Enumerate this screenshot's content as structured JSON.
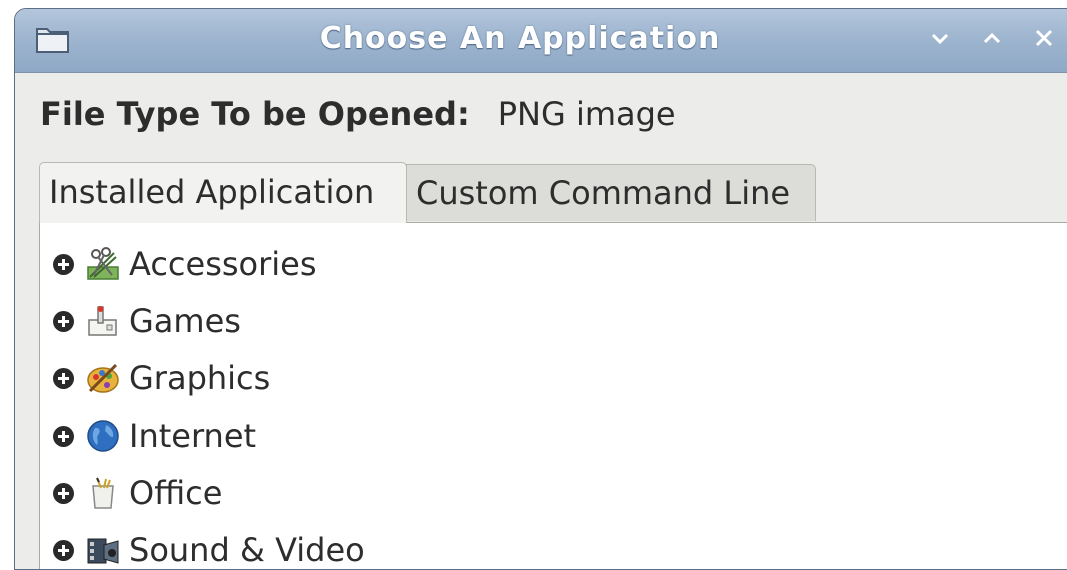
{
  "window": {
    "title": "Choose An Application",
    "controls": {
      "minimize_glyph": "⌄",
      "maximize_glyph": "⌃",
      "close_glyph": "✕"
    }
  },
  "file_type": {
    "label": "File Type To be Opened:",
    "value": "PNG image"
  },
  "tabs": [
    {
      "label": "Installed Application",
      "active": true
    },
    {
      "label": "Custom Command Line",
      "active": false
    }
  ],
  "categories": [
    {
      "label": "Accessories",
      "icon": "accessories-icon"
    },
    {
      "label": "Games",
      "icon": "games-icon"
    },
    {
      "label": "Graphics",
      "icon": "graphics-icon"
    },
    {
      "label": "Internet",
      "icon": "internet-icon"
    },
    {
      "label": "Office",
      "icon": "office-icon"
    },
    {
      "label": "Sound & Video",
      "icon": "sound-video-icon"
    }
  ],
  "colors": {
    "titlebar": "#9db4ce",
    "window_bg": "#ececea",
    "panel_bg": "#ffffff"
  }
}
